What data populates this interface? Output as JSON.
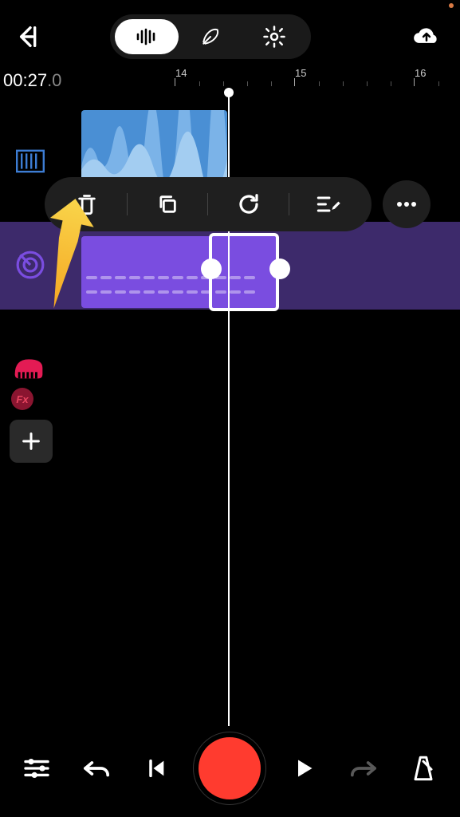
{
  "topbar": {
    "tabs": [
      "audio",
      "lyrics",
      "settings"
    ],
    "active_tab": "audio"
  },
  "time": {
    "display": "00:27",
    "fraction": ".0"
  },
  "ruler": {
    "marks": [
      "14",
      "15",
      "16"
    ]
  },
  "tracks": {
    "track1": {
      "type": "audio-waveform"
    },
    "track2": {
      "type": "midi-drums"
    },
    "track3": {
      "type": "piano",
      "fx": "Fx"
    }
  },
  "action_bar": {
    "items": [
      "delete",
      "copy",
      "loop",
      "edit"
    ]
  },
  "transport": {
    "items": [
      "mixer",
      "undo",
      "prev",
      "record",
      "play",
      "redo",
      "metronome"
    ]
  },
  "colors": {
    "accent_record": "#ff3b2f",
    "audio_clip": "#4a8fd4",
    "midi_clip": "#7a4de0",
    "midi_bg": "#3d2a6b",
    "arrow": "#f7c948"
  }
}
